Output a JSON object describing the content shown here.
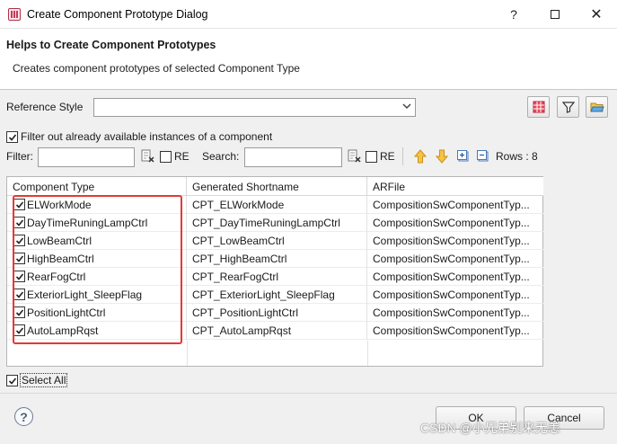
{
  "window": {
    "title": "Create Component Prototype Dialog",
    "help_symbol": "?",
    "close_symbol": "✕"
  },
  "banner": {
    "title": "Helps to Create Component Prototypes",
    "description": "Creates component prototypes of selected Component Type"
  },
  "reference_style": {
    "label": "Reference Style",
    "value": ""
  },
  "filter_checkbox": {
    "label": "Filter out already available instances of a component",
    "checked": true
  },
  "filter_row": {
    "filter_label": "Filter:",
    "filter_value": "",
    "re_label_1": "RE",
    "search_label": "Search:",
    "search_value": "",
    "re_label_2": "RE",
    "rows_label": "Rows : 8"
  },
  "table": {
    "headers": [
      "Component Type",
      "Generated Shortname",
      "ARFile"
    ],
    "rows": [
      {
        "type": "ELWorkMode",
        "shortname": "CPT_ELWorkMode",
        "arfile": "CompositionSwComponentTyp..."
      },
      {
        "type": "DayTimeRuningLampCtrl",
        "shortname": "CPT_DayTimeRuningLampCtrl",
        "arfile": "CompositionSwComponentTyp..."
      },
      {
        "type": "LowBeamCtrl",
        "shortname": "CPT_LowBeamCtrl",
        "arfile": "CompositionSwComponentTyp..."
      },
      {
        "type": "HighBeamCtrl",
        "shortname": "CPT_HighBeamCtrl",
        "arfile": "CompositionSwComponentTyp..."
      },
      {
        "type": "RearFogCtrl",
        "shortname": "CPT_RearFogCtrl",
        "arfile": "CompositionSwComponentTyp..."
      },
      {
        "type": "ExteriorLight_SleepFlag",
        "shortname": "CPT_ExteriorLight_SleepFlag",
        "arfile": "CompositionSwComponentTyp..."
      },
      {
        "type": "PositionLightCtrl",
        "shortname": "CPT_PositionLightCtrl",
        "arfile": "CompositionSwComponentTyp..."
      },
      {
        "type": "AutoLampRqst",
        "shortname": "CPT_AutoLampRqst",
        "arfile": "CompositionSwComponentTyp..."
      }
    ]
  },
  "select_all": {
    "label": "Select All",
    "checked": true
  },
  "buttons": {
    "ok": "OK",
    "cancel": "Cancel",
    "help": "?"
  },
  "watermark": "CSDN @小兄弟别来无恙",
  "colors": {
    "highlight_box": "#e53935"
  }
}
